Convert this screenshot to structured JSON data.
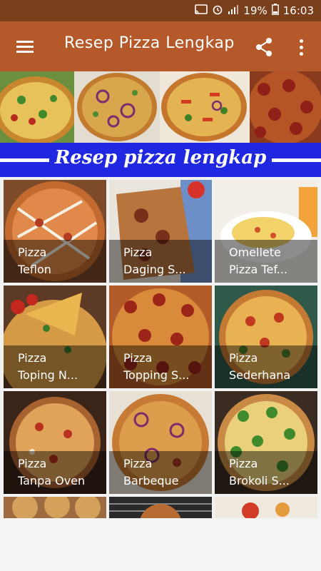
{
  "status_bar": {
    "battery": "19%",
    "time": "16:03"
  },
  "app_bar": {
    "title": "Resep Pizza Lengkap",
    "icons": [
      "menu-icon",
      "share-icon",
      "more-vert-icon"
    ]
  },
  "banner": {
    "title": "Resep pizza lengkap"
  },
  "recipes": [
    {
      "line1": "Pizza",
      "line2": "Teflon"
    },
    {
      "line1": "Pizza",
      "line2": "Daging S..."
    },
    {
      "line1": "Omellete",
      "line2": "Pizza Tef..."
    },
    {
      "line1": "Pizza",
      "line2": "Toping N..."
    },
    {
      "line1": "Pizza",
      "line2": "Topping S..."
    },
    {
      "line1": "Pizza",
      "line2": "Sederhana"
    },
    {
      "line1": "Pizza",
      "line2": "Tanpa Oven"
    },
    {
      "line1": "Pizza",
      "line2": "Barbeque"
    },
    {
      "line1": "Pizza",
      "line2": "Brokoli S..."
    }
  ],
  "colors": {
    "status_bar": "#7a3f1b",
    "app_bar": "#b5582a",
    "banner_strip": "#1f27e0"
  }
}
